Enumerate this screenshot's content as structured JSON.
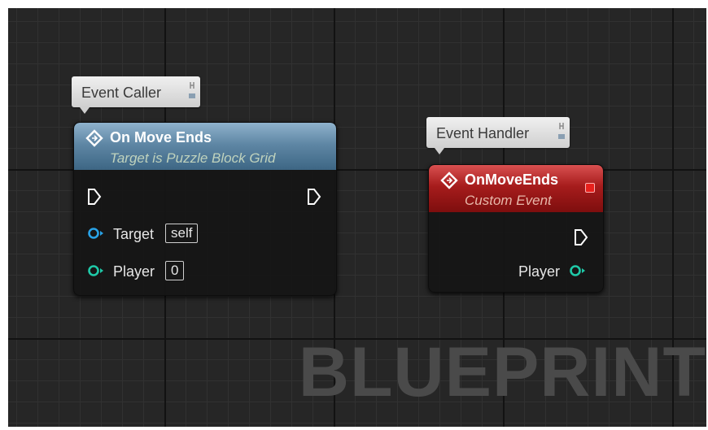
{
  "watermark": "BLUEPRINT",
  "comments": {
    "caller": "Event Caller",
    "handler": "Event Handler"
  },
  "caller_node": {
    "title": "On Move Ends",
    "subtitle": "Target is Puzzle Block Grid",
    "header_color": "#5f87a5",
    "pins": {
      "target_label": "Target",
      "target_value": "self",
      "player_label": "Player",
      "player_value": "0"
    }
  },
  "handler_node": {
    "title": "OnMoveEnds",
    "subtitle": "Custom Event",
    "header_color": "#a61c1c",
    "pins": {
      "player_label": "Player"
    }
  },
  "colors": {
    "object_pin": "#29a3e8",
    "int_pin": "#1fc9a8",
    "exec_pin": "#ffffff"
  },
  "icons": [
    "event-diamond-icon",
    "exec-pin-icon",
    "object-pin-icon",
    "integer-pin-icon",
    "comment-pin-icon",
    "stop-icon"
  ]
}
